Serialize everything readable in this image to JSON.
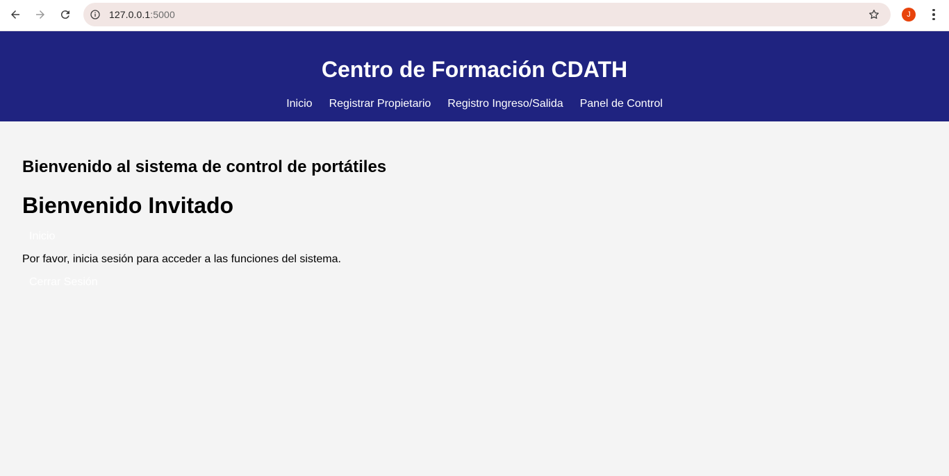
{
  "browser": {
    "url_host": "127.0.0.1",
    "url_port": ":5000",
    "profile_initial": "J",
    "icons": [
      "back-icon",
      "forward-icon",
      "reload-icon",
      "site-info-icon",
      "bookmark-star-icon",
      "more-menu-icon"
    ]
  },
  "header": {
    "title": "Centro de Formación CDATH",
    "nav": [
      {
        "label": "Inicio"
      },
      {
        "label": "Registrar Propietario"
      },
      {
        "label": "Registro Ingreso/Salida"
      },
      {
        "label": "Panel de Control"
      }
    ]
  },
  "main": {
    "welcome_subtitle": "Bienvenido al sistema de control de portátiles",
    "welcome_user": "Bienvenido Invitado",
    "inicio_link": "Inicio",
    "login_message": "Por favor, inicia sesión para acceder a las funciones del sistema.",
    "logout_link": "Cerrar Sesión"
  },
  "colors": {
    "header_bg": "#1f2380",
    "page_bg": "#f4f4f4",
    "omnibox_bg": "#f2e6e4",
    "profile_bg": "#e8430b"
  }
}
